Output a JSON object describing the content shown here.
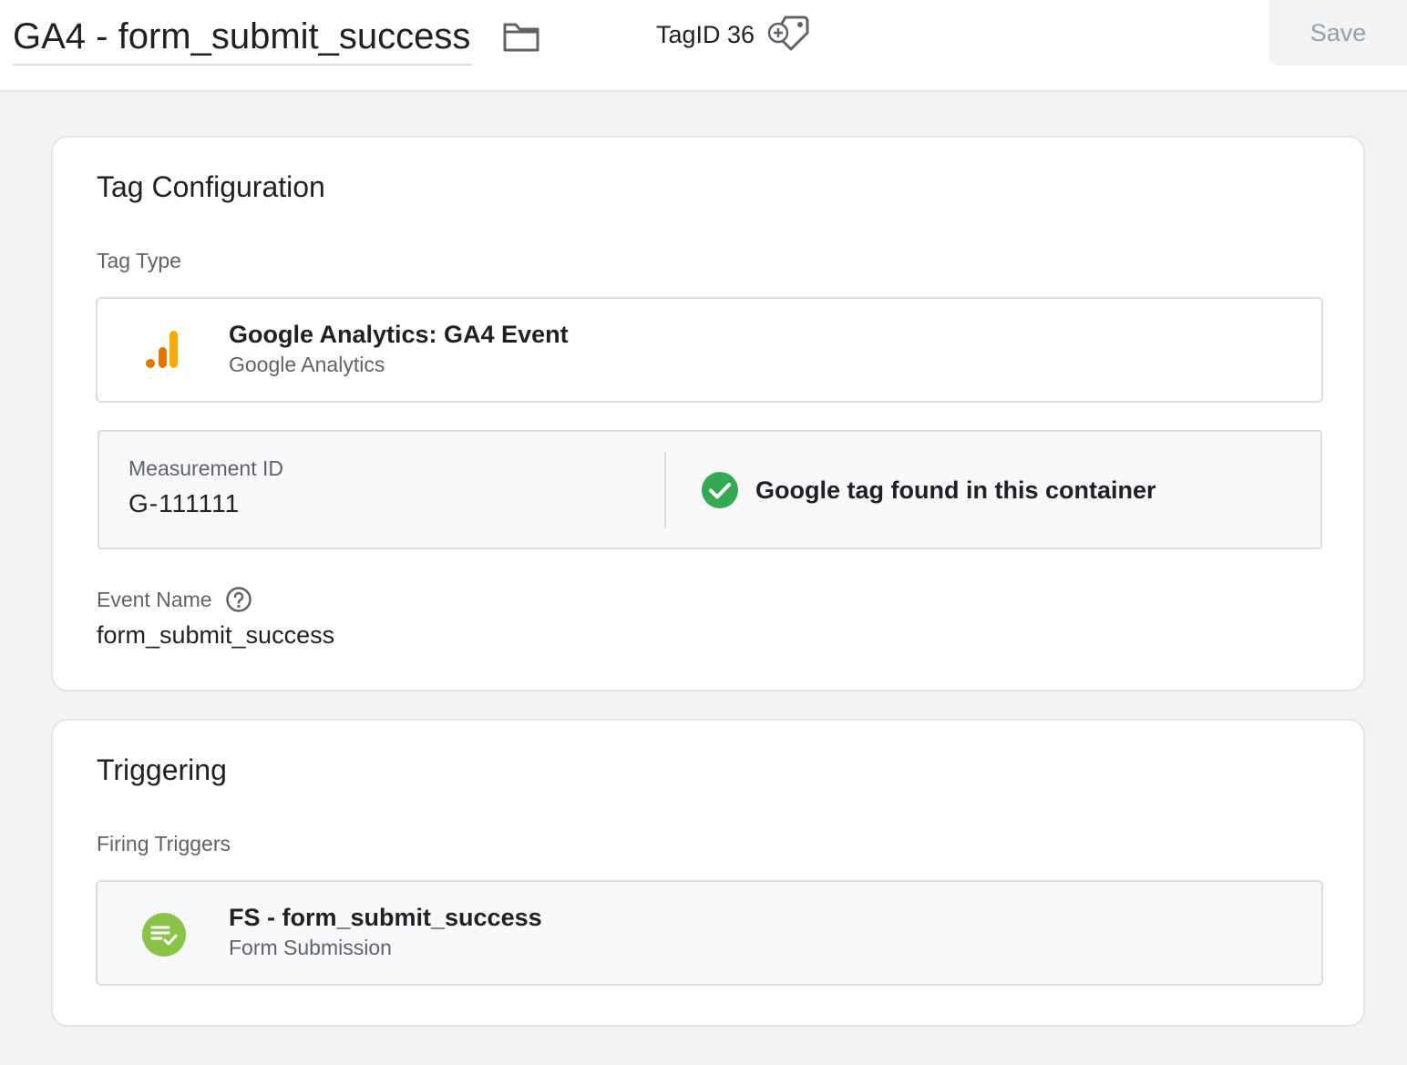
{
  "header": {
    "title": "GA4 - form_submit_success",
    "tag_id_label": "TagID 36",
    "save_label": "Save",
    "icons": {
      "folder": "folder-icon",
      "tag_id": "tag-add-icon"
    }
  },
  "tag_configuration": {
    "title": "Tag Configuration",
    "tag_type_label": "Tag Type",
    "tag_type": {
      "icon": "google-analytics-icon",
      "name": "Google Analytics: GA4 Event",
      "provider": "Google Analytics"
    },
    "measurement": {
      "label": "Measurement ID",
      "value": "G-111111",
      "status_icon": "check-circle-icon",
      "status_text": "Google tag found in this container"
    },
    "event_name": {
      "label": "Event Name",
      "help_icon": "help-icon",
      "value": "form_submit_success"
    }
  },
  "triggering": {
    "title": "Triggering",
    "firing_label": "Firing Triggers",
    "trigger": {
      "icon": "form-submission-icon",
      "name": "FS - form_submit_success",
      "type": "Form Submission"
    }
  },
  "colors": {
    "background": "#f1f3f4",
    "ga_orange_dark": "#e37400",
    "ga_orange_light": "#f9ab00",
    "check_green": "#34a853",
    "trigger_green": "#8bc34a"
  }
}
